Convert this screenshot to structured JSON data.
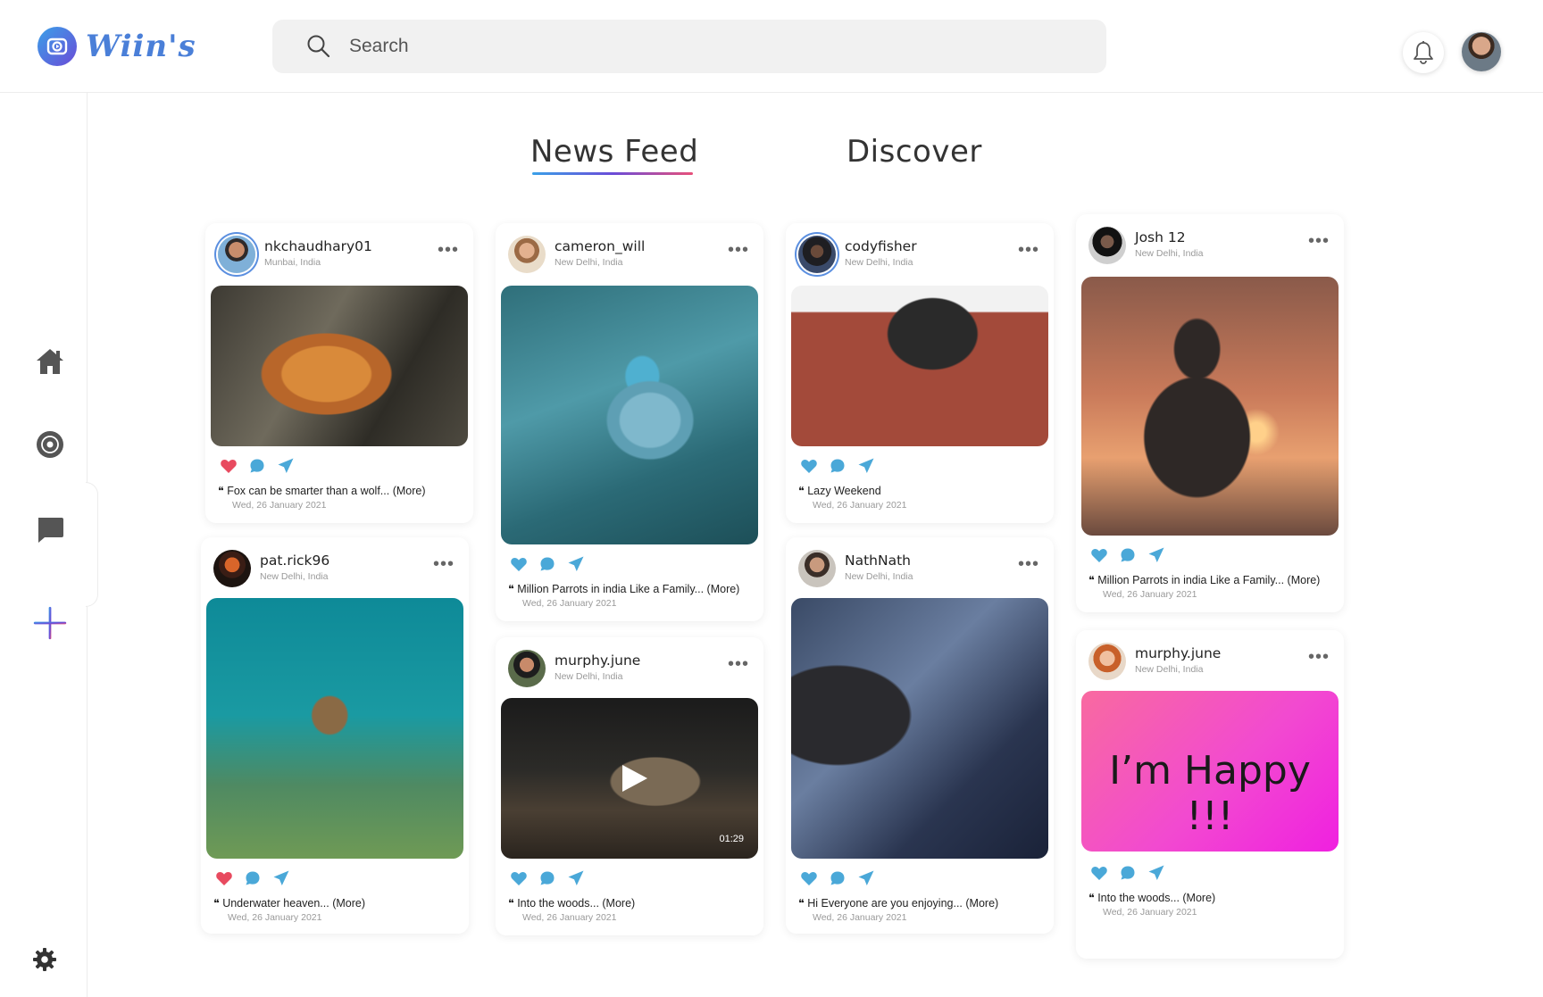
{
  "app": {
    "brand": "Wiin's"
  },
  "search": {
    "placeholder": "Search"
  },
  "tabs": [
    {
      "label": "News Feed",
      "active": true
    },
    {
      "label": "Discover",
      "active": false
    }
  ],
  "sidebar": {
    "items": [
      {
        "name": "home",
        "icon": "home-icon"
      },
      {
        "name": "discover",
        "icon": "disc-icon"
      },
      {
        "name": "messages",
        "icon": "chat-icon"
      },
      {
        "name": "create",
        "icon": "plus-icon"
      },
      {
        "name": "settings",
        "icon": "gear-icon"
      }
    ]
  },
  "colors": {
    "accent": "#3aa0e8",
    "like": "#e84a5f",
    "icon": "#4aa8d8"
  },
  "posts": [
    {
      "username": "nkchaudhary01",
      "location": "Munbai, India",
      "caption": "Fox can be smarter than a wolf... (More)",
      "date": "Wed, 26 January 2021",
      "liked": true
    },
    {
      "username": "pat.rick96",
      "location": "New Delhi, India",
      "caption": "Underwater heaven... (More)",
      "date": "Wed, 26 January 2021",
      "liked": true
    },
    {
      "username": "cameron_will",
      "location": "New Delhi, India",
      "caption": "Million Parrots in india Like a Family... (More)",
      "date": "Wed, 26 January 2021",
      "liked": false
    },
    {
      "username": "murphy.june",
      "location": "New Delhi, India",
      "caption": "Into the woods... (More)",
      "date": "Wed, 26 January 2021",
      "liked": false,
      "duration": "01:29"
    },
    {
      "username": "codyfisher",
      "location": "New Delhi, India",
      "caption": "Lazy Weekend",
      "date": "Wed, 26 January 2021",
      "liked": false
    },
    {
      "username": "NathNath",
      "location": "New Delhi, India",
      "caption": "Hi Everyone are you enjoying... (More)",
      "date": "Wed, 26 January 2021",
      "liked": false
    },
    {
      "username": "Josh 12",
      "location": "New Delhi, India",
      "caption": "Million Parrots in india Like a Family... (More)",
      "date": "Wed, 26 January 2021",
      "liked": false
    },
    {
      "username": "murphy.june",
      "location": "New Delhi, India",
      "caption": "Into the woods... (More)",
      "date": "Wed, 26 January 2021",
      "liked": false,
      "text_post": "I’m Happy !!!"
    }
  ]
}
